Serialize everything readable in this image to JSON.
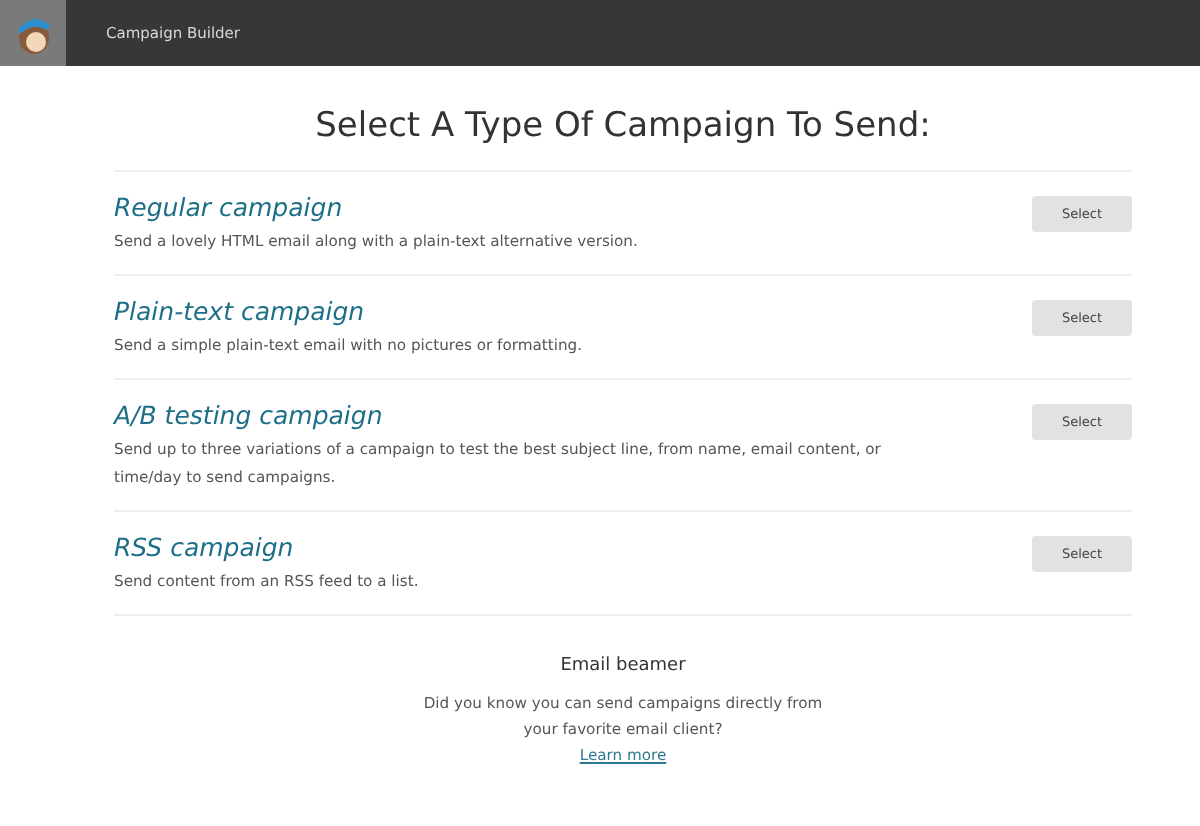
{
  "header": {
    "title": "Campaign Builder"
  },
  "heading": "Select A Type Of Campaign To Send:",
  "campaigns": [
    {
      "name": "Regular campaign",
      "description": "Send a lovely HTML email along with a plain-text alternative version.",
      "button": "Select"
    },
    {
      "name": "Plain-text campaign",
      "description": "Send a simple plain-text email with no pictures or formatting.",
      "button": "Select"
    },
    {
      "name": "A/B testing campaign",
      "description": "Send up to three variations of a campaign to test the best subject line, from name, email content, or time/day to send campaigns.",
      "button": "Select"
    },
    {
      "name": "RSS campaign",
      "description": "Send content from an RSS feed to a list.",
      "button": "Select"
    }
  ],
  "promo": {
    "title": "Email beamer",
    "text": "Did you know you can send campaigns directly from your favorite email client?",
    "link": "Learn more"
  }
}
